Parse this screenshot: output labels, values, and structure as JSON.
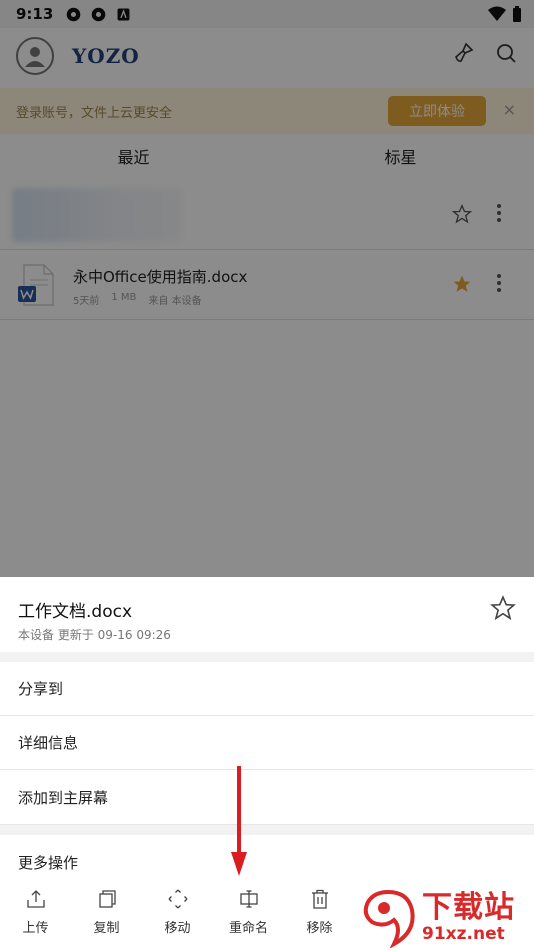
{
  "status_bar": {
    "time": "9:13"
  },
  "header": {
    "brand": "YOZO"
  },
  "banner": {
    "text": "登录账号，文件上云更安全",
    "button": "立即体验",
    "close": "×"
  },
  "tabs": [
    {
      "label": "最近"
    },
    {
      "label": "标星"
    }
  ],
  "files": [
    {
      "name": "",
      "meta_time": "",
      "meta_size": "",
      "meta_source": "",
      "starred": false
    },
    {
      "name": "永中Office使用指南.docx",
      "meta_time": "5天前",
      "meta_size": "1 MB",
      "meta_source": "来自 本设备",
      "starred": true
    }
  ],
  "sheet": {
    "title": "工作文档.docx",
    "subtitle": "本设备 更新于 09-16 09:26",
    "menu": [
      {
        "label": "分享到"
      },
      {
        "label": "详细信息"
      },
      {
        "label": "添加到主屏幕"
      },
      {
        "label": "更多操作"
      }
    ],
    "toolbar": [
      {
        "label": "上传",
        "icon": "upload-icon"
      },
      {
        "label": "复制",
        "icon": "copy-icon"
      },
      {
        "label": "移动",
        "icon": "move-icon"
      },
      {
        "label": "重命名",
        "icon": "rename-icon"
      },
      {
        "label": "移除",
        "icon": "delete-icon"
      }
    ]
  },
  "watermark": {
    "main": "下载站",
    "sub": "91xz.net"
  },
  "colors": {
    "accent": "#e6a63a",
    "brand": "#21407a",
    "star": "#e6a63a",
    "arrow": "#d81e1e"
  }
}
